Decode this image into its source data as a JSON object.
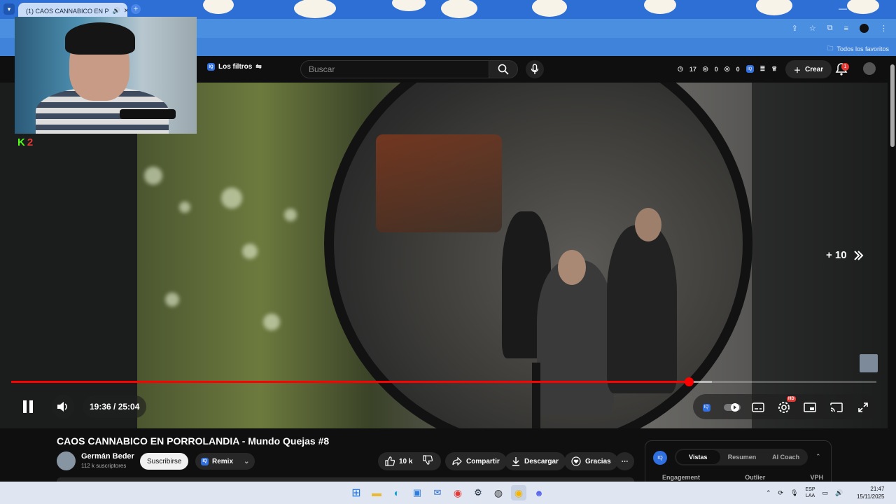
{
  "browser": {
    "tab_title": "(1) CAOS CANNABICO EN P",
    "bookmark_folder": "Todos los favoritos",
    "new_tab": "+",
    "minimize": "—"
  },
  "header": {
    "filters_label": "Los filtros",
    "search_placeholder": "Buscar",
    "stats": {
      "s1": "17",
      "s2": "0",
      "s3": "0"
    },
    "create_label": "Crear",
    "notif_count": "1"
  },
  "player": {
    "time": "19:36 / 25:04",
    "progress": 0.7835,
    "buffered": 0.81,
    "skip_label": "+ 10",
    "hd_badge": "HD"
  },
  "overlay": {
    "kick_letter": "K",
    "kick_count": "2"
  },
  "video": {
    "title": "CAOS CANNABICO EN PORROLANDIA - Mundo Quejas #8",
    "channel": "Germán Beder",
    "subscribers": "112 k suscriptores",
    "subscribe_label": "Suscribirse",
    "remix_label": "Remix",
    "likes": "10 k",
    "share_label": "Compartir",
    "download_label": "Descargar",
    "thanks_label": "Gracias"
  },
  "side_panel": {
    "tabs": [
      "Vistas",
      "Resumen",
      "AI Coach"
    ],
    "labels": [
      "Engagement",
      "Outlier",
      "VPH"
    ]
  },
  "taskbar": {
    "lang_1": "ESP",
    "lang_2": "LAA",
    "time": "21:47",
    "date": "15/11/2025"
  }
}
